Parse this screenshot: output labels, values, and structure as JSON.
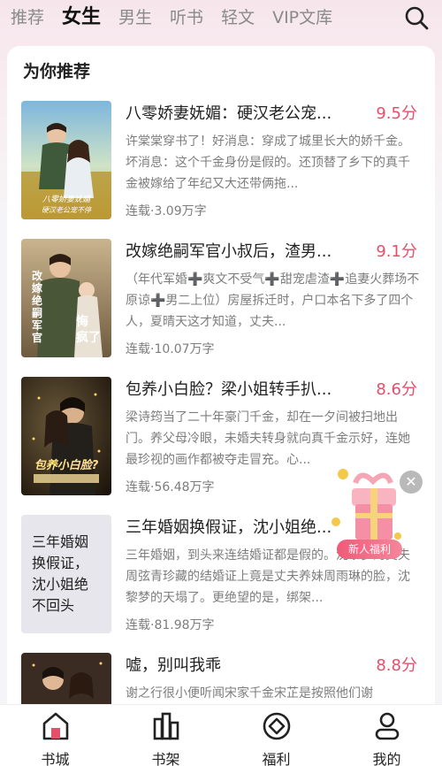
{
  "tabs": [
    "推荐",
    "女生",
    "男生",
    "听书",
    "轻文",
    "VIP文库"
  ],
  "section_title": "为你推荐",
  "books": [
    {
      "title": "八零娇妻妩媚：硬汉老公宠...",
      "score": "9.5分",
      "desc": "许棠棠穿书了！好消息：穿成了城里长大的娇千金。坏消息：这个千金身份是假的。还顶替了乡下的真千金被嫁给了年纪又大还带俩拖...",
      "meta": "连载·3.09万字",
      "cover_text": ""
    },
    {
      "title": "改嫁绝嗣军官小叔后，渣男...",
      "score": "9.1分",
      "desc": "（年代军婚➕爽文不受气➕甜宠虐渣➕追妻火葬场不原谅➕男二上位）房屋拆迁时，户口本名下多了四个人，夏晴天这才知道，丈夫...",
      "meta": "连载·10.07万字",
      "cover_text": ""
    },
    {
      "title": "包养小白脸？梁小姐转手扒...",
      "score": "8.6分",
      "desc": "梁诗筠当了二十年豪门千金，却在一夕间被扫地出门。养父母冷眼，未婚夫转身就向真千金示好，连她最珍视的画作都被夺走冒充。心...",
      "meta": "连载·56.48万字",
      "cover_text": ""
    },
    {
      "title": "三年婚姻换假证，沈小姐绝...",
      "score": "",
      "desc": "三年婚姻，到头来连结婚证都是假的。沈黎梦的丈夫周弦青珍藏的结婚证上竟是丈夫养妹周雨琳的脸，沈黎梦的天塌了。更绝望的是，绑架...",
      "meta": "连载·81.98万字",
      "cover_text": "三年婚姻换假证，沈小姐绝不回头"
    },
    {
      "title": "嘘，别叫我乖",
      "score": "8.8分",
      "desc": "谢之行很小便听闻宋家千金宋芷是按照他们谢",
      "meta": "",
      "cover_text": ""
    }
  ],
  "gift": {
    "label": "新人福利"
  },
  "nav": [
    {
      "label": "书城",
      "icon": "home-icon",
      "active": true
    },
    {
      "label": "书架",
      "icon": "bookshelf-icon",
      "active": false
    },
    {
      "label": "福利",
      "icon": "welfare-icon",
      "active": false
    },
    {
      "label": "我的",
      "icon": "user-icon",
      "active": false
    }
  ],
  "colors": {
    "accent": "#e2506a",
    "score": "#e2506a"
  }
}
